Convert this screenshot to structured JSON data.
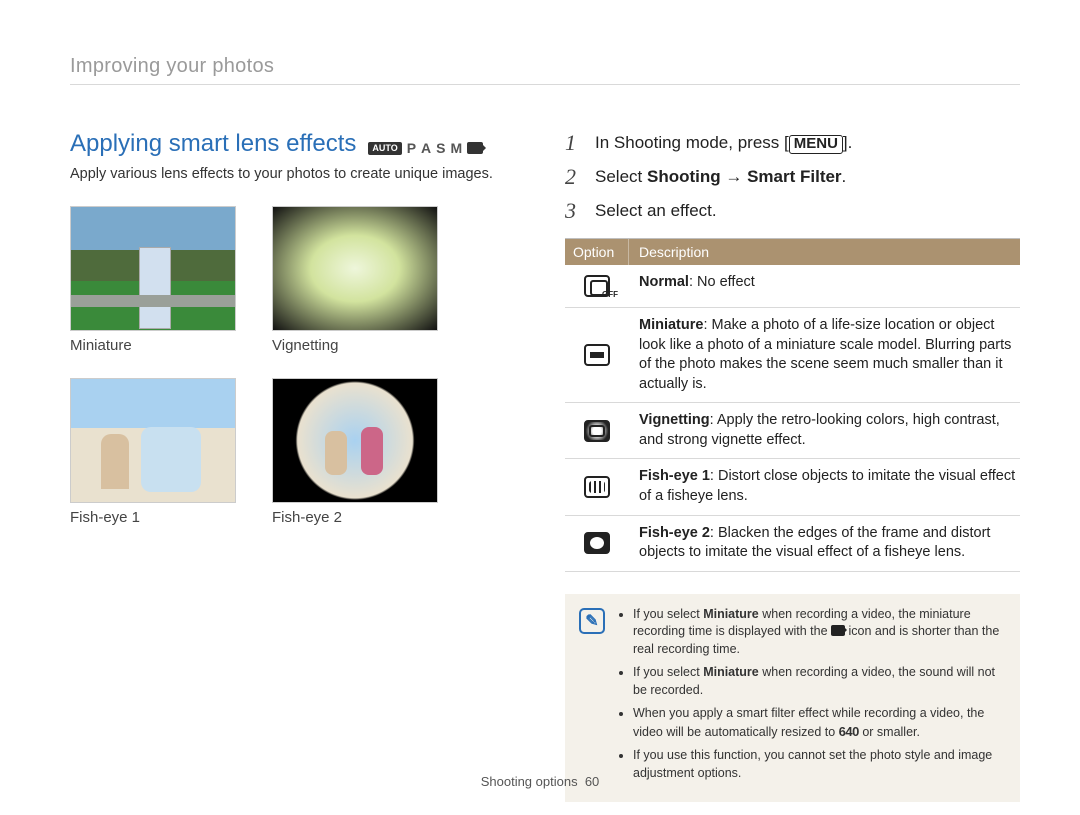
{
  "breadcrumb": "Improving your photos",
  "title": "Applying smart lens effects",
  "mode_icons": {
    "auto": "AUTO",
    "p": "P",
    "a": "A",
    "s": "S",
    "m": "M"
  },
  "intro": "Apply various lens effects to your photos to create unique images.",
  "thumbs": [
    {
      "label": "Miniature"
    },
    {
      "label": "Vignetting"
    },
    {
      "label": "Fish-eye 1"
    },
    {
      "label": "Fish-eye 2"
    }
  ],
  "steps": [
    {
      "num": "1",
      "pre": "In Shooting mode, press [",
      "chip": "MENU",
      "post": "]."
    },
    {
      "num": "2",
      "pre": "Select ",
      "bold": "Shooting → Smart Filter",
      "post": "."
    },
    {
      "num": "3",
      "pre": "Select an effect.",
      "bold": "",
      "post": ""
    }
  ],
  "table": {
    "head_option": "Option",
    "head_desc": "Description",
    "rows": [
      {
        "name": "Normal",
        "desc": ": No effect"
      },
      {
        "name": "Miniature",
        "desc": ": Make a photo of a life-size location or object look like a photo of a miniature scale model. Blurring parts of the photo makes the scene seem much smaller than it actually is."
      },
      {
        "name": "Vignetting",
        "desc": ": Apply the retro-looking colors, high contrast, and strong vignette effect."
      },
      {
        "name": "Fish-eye 1",
        "desc": ": Distort close objects to imitate the visual effect of a fisheye lens."
      },
      {
        "name": "Fish-eye 2",
        "desc": ": Blacken the edges of the frame and distort objects to imitate the visual effect of a fisheye lens."
      }
    ]
  },
  "notes": {
    "items": [
      {
        "pre": "If you select ",
        "b1": "Miniature",
        "mid": " when recording a video, the miniature recording time is displayed with the ",
        "chip": "video",
        "post": " icon and is shorter than the real recording time."
      },
      {
        "pre": "If you select ",
        "b1": "Miniature",
        "mid": " when recording a video, the sound will not be recorded.",
        "chip": "",
        "post": ""
      },
      {
        "pre": "When you apply a smart filter effect while recording a video, the video will be automatically resized to ",
        "b1": "",
        "mid": "",
        "chip": "640",
        "post": " or smaller."
      },
      {
        "pre": "If you use this function, you cannot set the photo style and image adjustment options.",
        "b1": "",
        "mid": "",
        "chip": "",
        "post": ""
      }
    ]
  },
  "footer": {
    "section": "Shooting options",
    "page": "60"
  }
}
